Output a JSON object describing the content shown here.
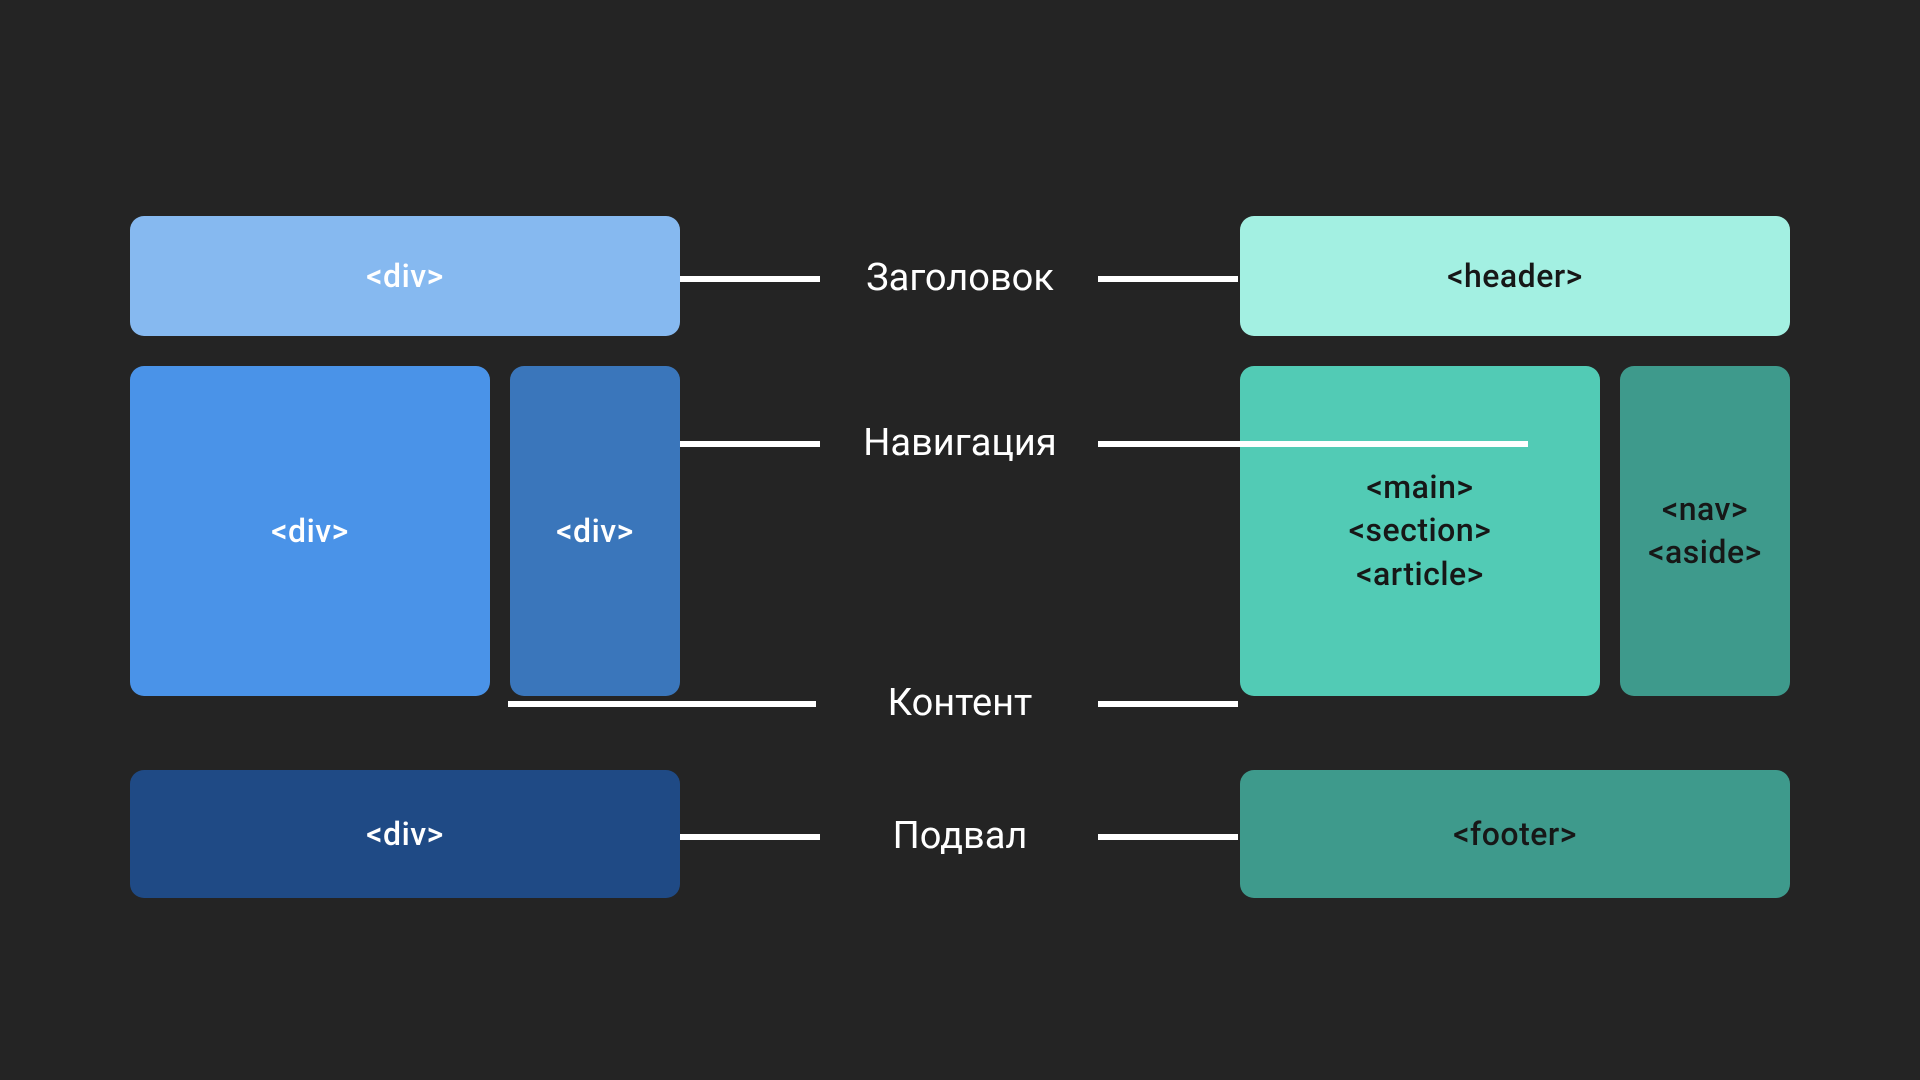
{
  "left": {
    "header": "<div>",
    "main": "<div>",
    "aside": "<div>",
    "footer": "<div>"
  },
  "right": {
    "header": "<header>",
    "main_line1": "<main>",
    "main_line2": "<section>",
    "main_line3": "<article>",
    "aside_line1": "<nav>",
    "aside_line2": "<aside>",
    "footer": "<footer>"
  },
  "labels": {
    "header": "Заголовок",
    "nav": "Навигация",
    "content": "Контент",
    "footer": "Подвал"
  },
  "colors": {
    "left_header": "#86b9f0",
    "left_main": "#4a93e8",
    "left_aside": "#3a76bb",
    "left_footer": "#1f4a85",
    "right_header": "#a3f0e2",
    "right_main": "#52cbb5",
    "right_aside": "#3e9a8c",
    "right_footer": "#3e9a8c"
  }
}
